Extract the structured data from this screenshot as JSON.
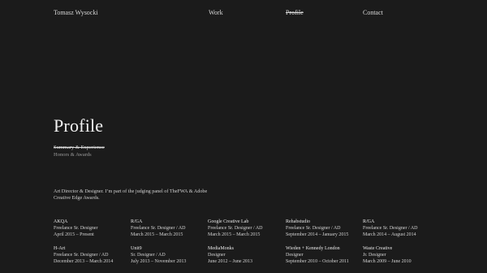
{
  "header": {
    "brand": "Tomasz Wysocki",
    "nav": [
      {
        "label": "Work",
        "active": false
      },
      {
        "label": "Profile",
        "active": true
      },
      {
        "label": "Contact",
        "active": false
      }
    ]
  },
  "hero": {
    "title": "Profile",
    "subnav": [
      {
        "label": "Summary & Experience",
        "active": true
      },
      {
        "label": "Honors & Awards",
        "active": false
      }
    ]
  },
  "bio": "Art Director & Designer. I’m part of the judging panel of TheFWA & Adobe Creative Edge Awards.",
  "experience": [
    {
      "company": "AKQA",
      "role": "Freelance Sr. Designer",
      "dates": "April 2015 – Present"
    },
    {
      "company": "R/GA",
      "role": "Freelance Sr. Designer / AD",
      "dates": "March 2015 – March 2015"
    },
    {
      "company": "Google Creative Lab",
      "role": "Freelance Sr. Designer / AD",
      "dates": "March 2015 – March 2015"
    },
    {
      "company": "Rehabstudio",
      "role": "Freelance Sr. Designer / AD",
      "dates": "September 2014 – January 2015"
    },
    {
      "company": "R/GA",
      "role": "Freelance Sr. Designer / AD",
      "dates": "March 2014 – August 2014"
    },
    {
      "company": "H-Art",
      "role": "Freelance Sr. Designer / AD",
      "dates": "December 2013 – March 2014"
    },
    {
      "company": "Unit9",
      "role": "Sr. Designer / AD",
      "dates": "July 2013 – November 2013"
    },
    {
      "company": "MediaMonks",
      "role": "Designer",
      "dates": "June 2012 – June 2013"
    },
    {
      "company": "Wieden + Kennedy London",
      "role": "Designer",
      "dates": "September 2010 – October 2011"
    },
    {
      "company": "Waste Creative",
      "role": "Jr. Designer",
      "dates": "March 2009 – June 2010"
    }
  ],
  "colors": {
    "background": "#1b1b1b",
    "text": "#e6e6e6",
    "muted": "#9a9a9a"
  }
}
